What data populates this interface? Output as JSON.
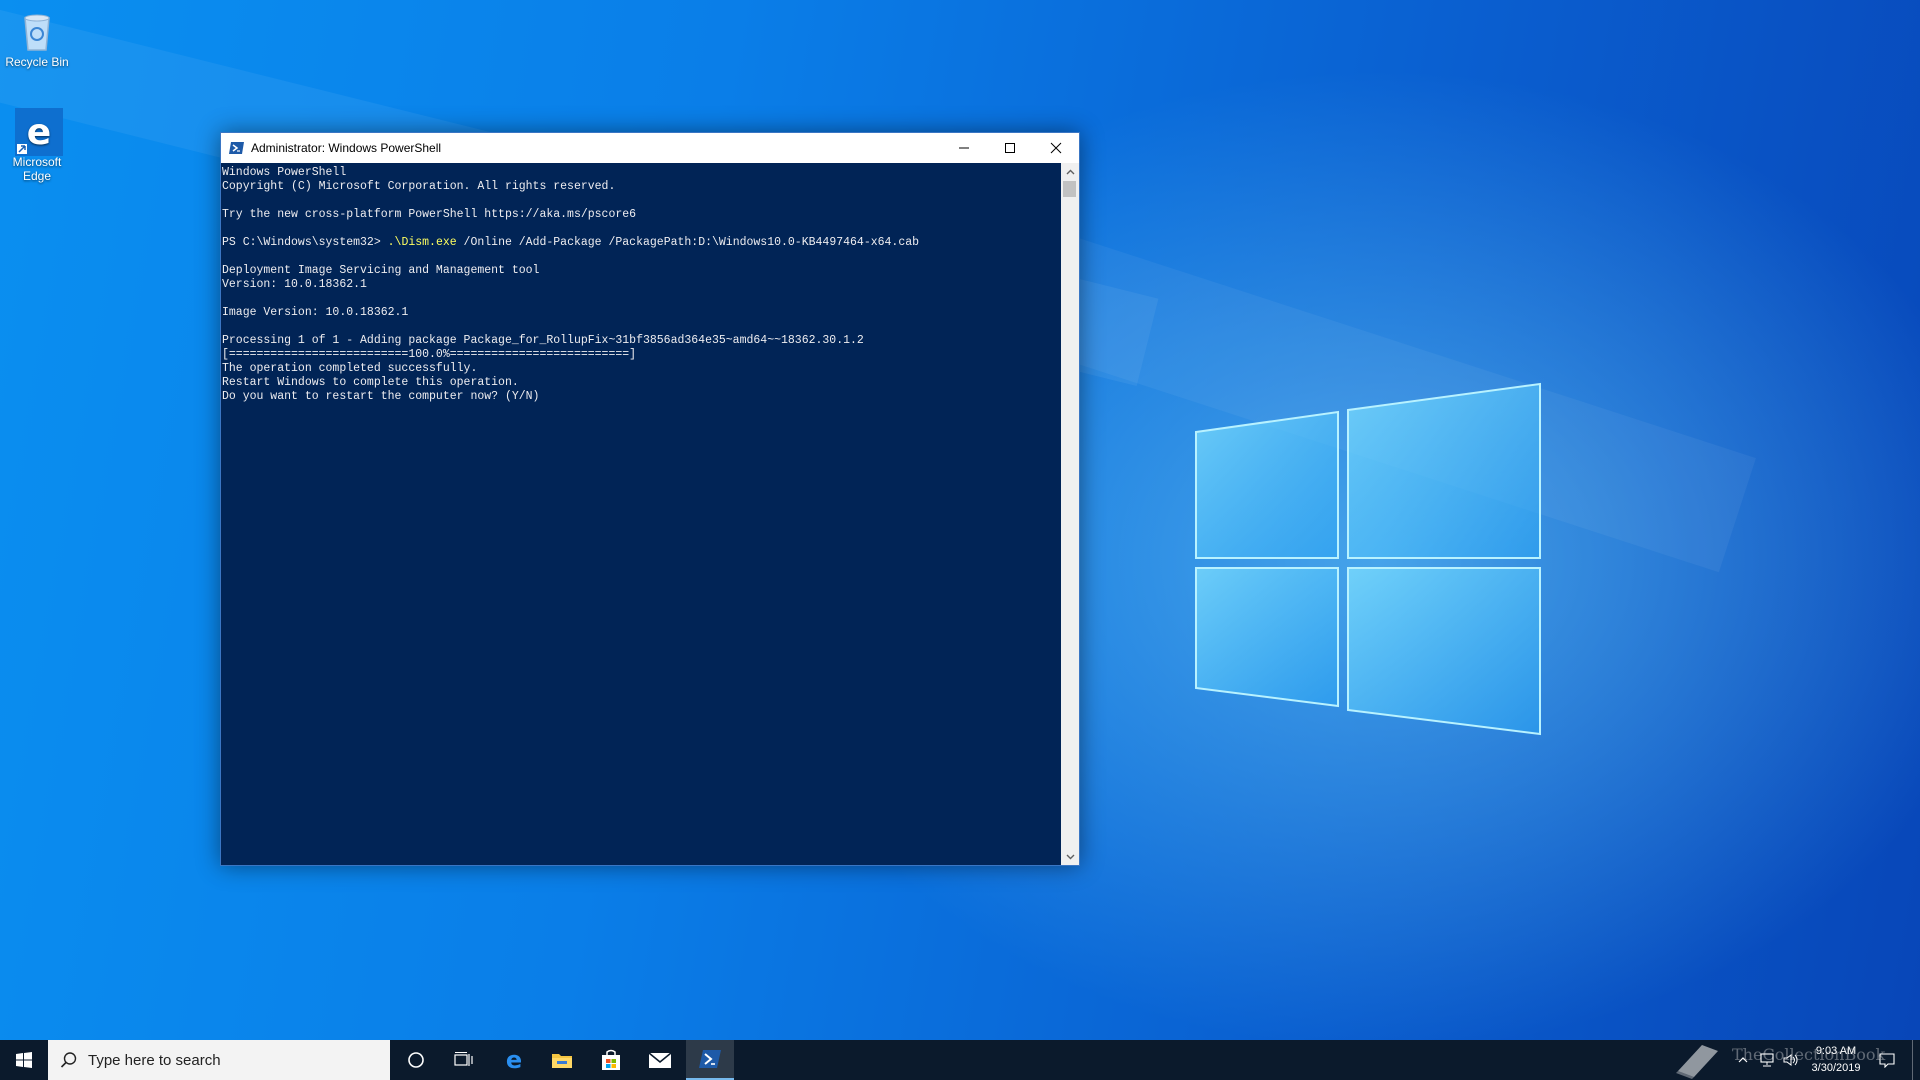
{
  "desktop": {
    "icons": [
      {
        "label": "Recycle Bin"
      },
      {
        "label": "Microsoft Edge"
      }
    ]
  },
  "window": {
    "title": "Administrator: Windows PowerShell",
    "console": {
      "lines": [
        "Windows PowerShell",
        "Copyright (C) Microsoft Corporation. All rights reserved.",
        "",
        "Try the new cross-platform PowerShell https://aka.ms/pscore6",
        "",
        "PS C:\\Windows\\system32> ",
        "",
        "Deployment Image Servicing and Management tool",
        "Version: 10.0.18362.1",
        "",
        "Image Version: 10.0.18362.1",
        "",
        "Processing 1 of 1 - Adding package Package_for_RollupFix~31bf3856ad364e35~amd64~~18362.30.1.2",
        "[==========================100.0%==========================]",
        "The operation completed successfully.",
        "Restart Windows to complete this operation.",
        "Do you want to restart the computer now? (Y/N)"
      ],
      "prompt": "PS C:\\Windows\\system32> ",
      "command_exe": ".\\Dism.exe",
      "command_args": " /Online /Add-Package /PackagePath:D:\\Windows10.0-KB4497464-x64.cab"
    }
  },
  "taskbar": {
    "search_placeholder": "Type here to search",
    "pinned": [
      "cortana-icon",
      "task-view-icon",
      "edge-icon",
      "file-explorer-icon",
      "store-icon",
      "mail-icon",
      "powershell-icon"
    ],
    "active_app": "powershell-icon",
    "tray": {
      "time": "9:03 AM",
      "date": "3/30/2019"
    }
  },
  "watermark": "TheCollectionBook",
  "colors": {
    "console_bg": "#012456",
    "console_text": "#eeedf0",
    "command_highlight": "#ffff60",
    "taskbar_bg": "#0b1a2c",
    "desktop_blue": "#0a74d6"
  }
}
